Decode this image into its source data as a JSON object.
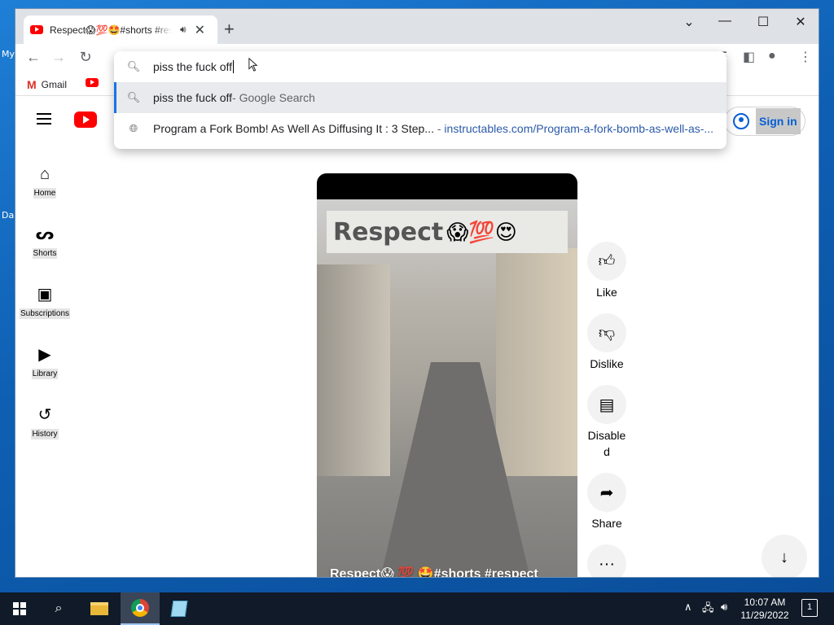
{
  "browser": {
    "tab_title": "Respect😱💯🤩#shorts #respect",
    "omnibox_value": "piss the fuck off",
    "suggestions": [
      {
        "main": "piss the fuck off",
        "suffix": " - Google Search",
        "type": "search"
      },
      {
        "main": "Program a Fork Bomb! As Well As Diffusing It : 3 Step...",
        "sep": " - ",
        "url": "instructables.com/Program-a-fork-bomb-as-well-as-...",
        "type": "history"
      }
    ],
    "bookmarks": [
      {
        "label": "Gmail"
      }
    ]
  },
  "youtube": {
    "signin_label": "Sign in",
    "sidebar": [
      {
        "label": "Home",
        "icon": "home-icon"
      },
      {
        "label": "Shorts",
        "icon": "shorts-icon"
      },
      {
        "label": "Subscriptions",
        "icon": "subscriptions-icon"
      },
      {
        "label": "Library",
        "icon": "library-icon"
      },
      {
        "label": "History",
        "icon": "history-icon"
      }
    ],
    "video": {
      "banner_text": "Respect",
      "banner_emoji": "😱💯😍",
      "caption": "Respect😱 💯 🤩#shorts #respect"
    },
    "actions": [
      {
        "label": "Like",
        "icon": "thumbs-up-icon"
      },
      {
        "label": "Dislike",
        "icon": "thumbs-down-icon"
      },
      {
        "label": "Disable\nd",
        "icon": "comments-icon"
      },
      {
        "label": "Share",
        "icon": "share-icon"
      },
      {
        "label": "",
        "icon": "more-icon"
      }
    ]
  },
  "desktop": {
    "fragment_1": "My",
    "fragment_2": "Da"
  },
  "taskbar": {
    "time": "10:07 AM",
    "date": "11/29/2022",
    "notifications_count": "1"
  }
}
